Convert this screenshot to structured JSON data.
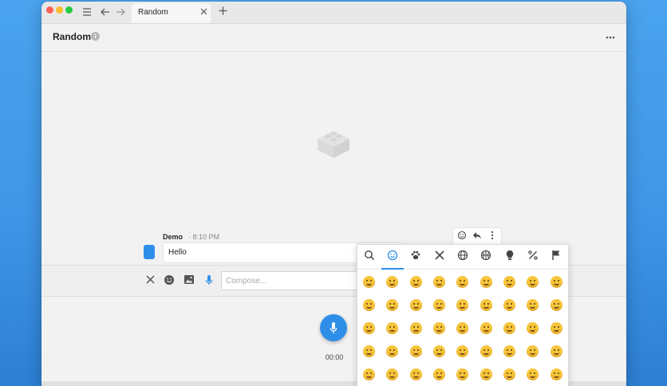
{
  "titlebar": {
    "tab_label": "Random",
    "menu_icon": "hamburger-icon",
    "back_icon": "arrow-left-icon",
    "forward_icon": "arrow-right-icon",
    "close_icon": "close-icon",
    "new_tab_icon": "plus-icon"
  },
  "header": {
    "room_title": "Random",
    "more_icon": "more-horizontal-icon"
  },
  "message": {
    "sender": "Demo",
    "time": "· 8:10 PM",
    "text": "Hello",
    "actions": [
      "add-reaction-icon",
      "reply-icon",
      "more-vertical-icon"
    ]
  },
  "composer": {
    "placeholder": "Compose...",
    "buttons": [
      "close-icon",
      "emoji-icon",
      "image-icon",
      "microphone-icon"
    ]
  },
  "recorder": {
    "time": "00:00"
  },
  "emoji_picker": {
    "categories": [
      "search",
      "smileys",
      "animals",
      "food",
      "travel",
      "activities",
      "objects",
      "symbols",
      "flags"
    ],
    "active_category": "smileys",
    "visible_count": 45
  },
  "colors": {
    "accent": "#2f8fe8",
    "desktop": "#3f96e6",
    "traffic_red": "#fe5f57",
    "traffic_yellow": "#febc2e",
    "traffic_green": "#28c840"
  }
}
